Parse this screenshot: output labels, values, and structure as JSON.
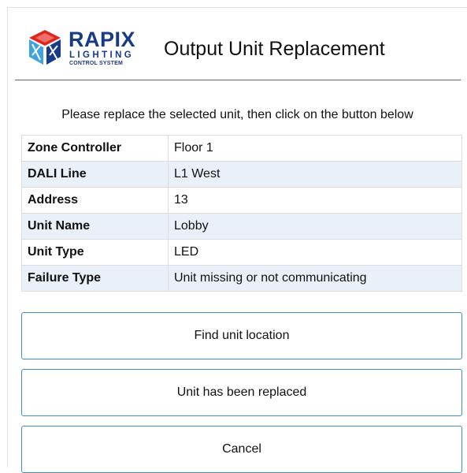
{
  "header": {
    "logo": {
      "brand": "RAPIX",
      "line1": "LIGHTING",
      "line2": "CONTROL SYSTEM",
      "colors": {
        "navy": "#173a8c",
        "red": "#e2261c",
        "blue": "#3fa2e2"
      }
    },
    "title": "Output Unit Replacement"
  },
  "instruction": "Please replace the selected unit, then click on the button below",
  "details": [
    {
      "label": "Zone Controller",
      "value": "Floor 1"
    },
    {
      "label": "DALI Line",
      "value": "L1 West"
    },
    {
      "label": "Address",
      "value": "13"
    },
    {
      "label": "Unit Name",
      "value": "Lobby"
    },
    {
      "label": "Unit Type",
      "value": "LED"
    },
    {
      "label": "Failure Type",
      "value": "Unit missing or not communicating"
    }
  ],
  "buttons": {
    "find": "Find unit location",
    "replaced": "Unit has been replaced",
    "cancel": "Cancel"
  },
  "colors": {
    "button_border": "#3f8fc4",
    "row_stripe": "#e9f0f8",
    "divider": "#666666"
  }
}
